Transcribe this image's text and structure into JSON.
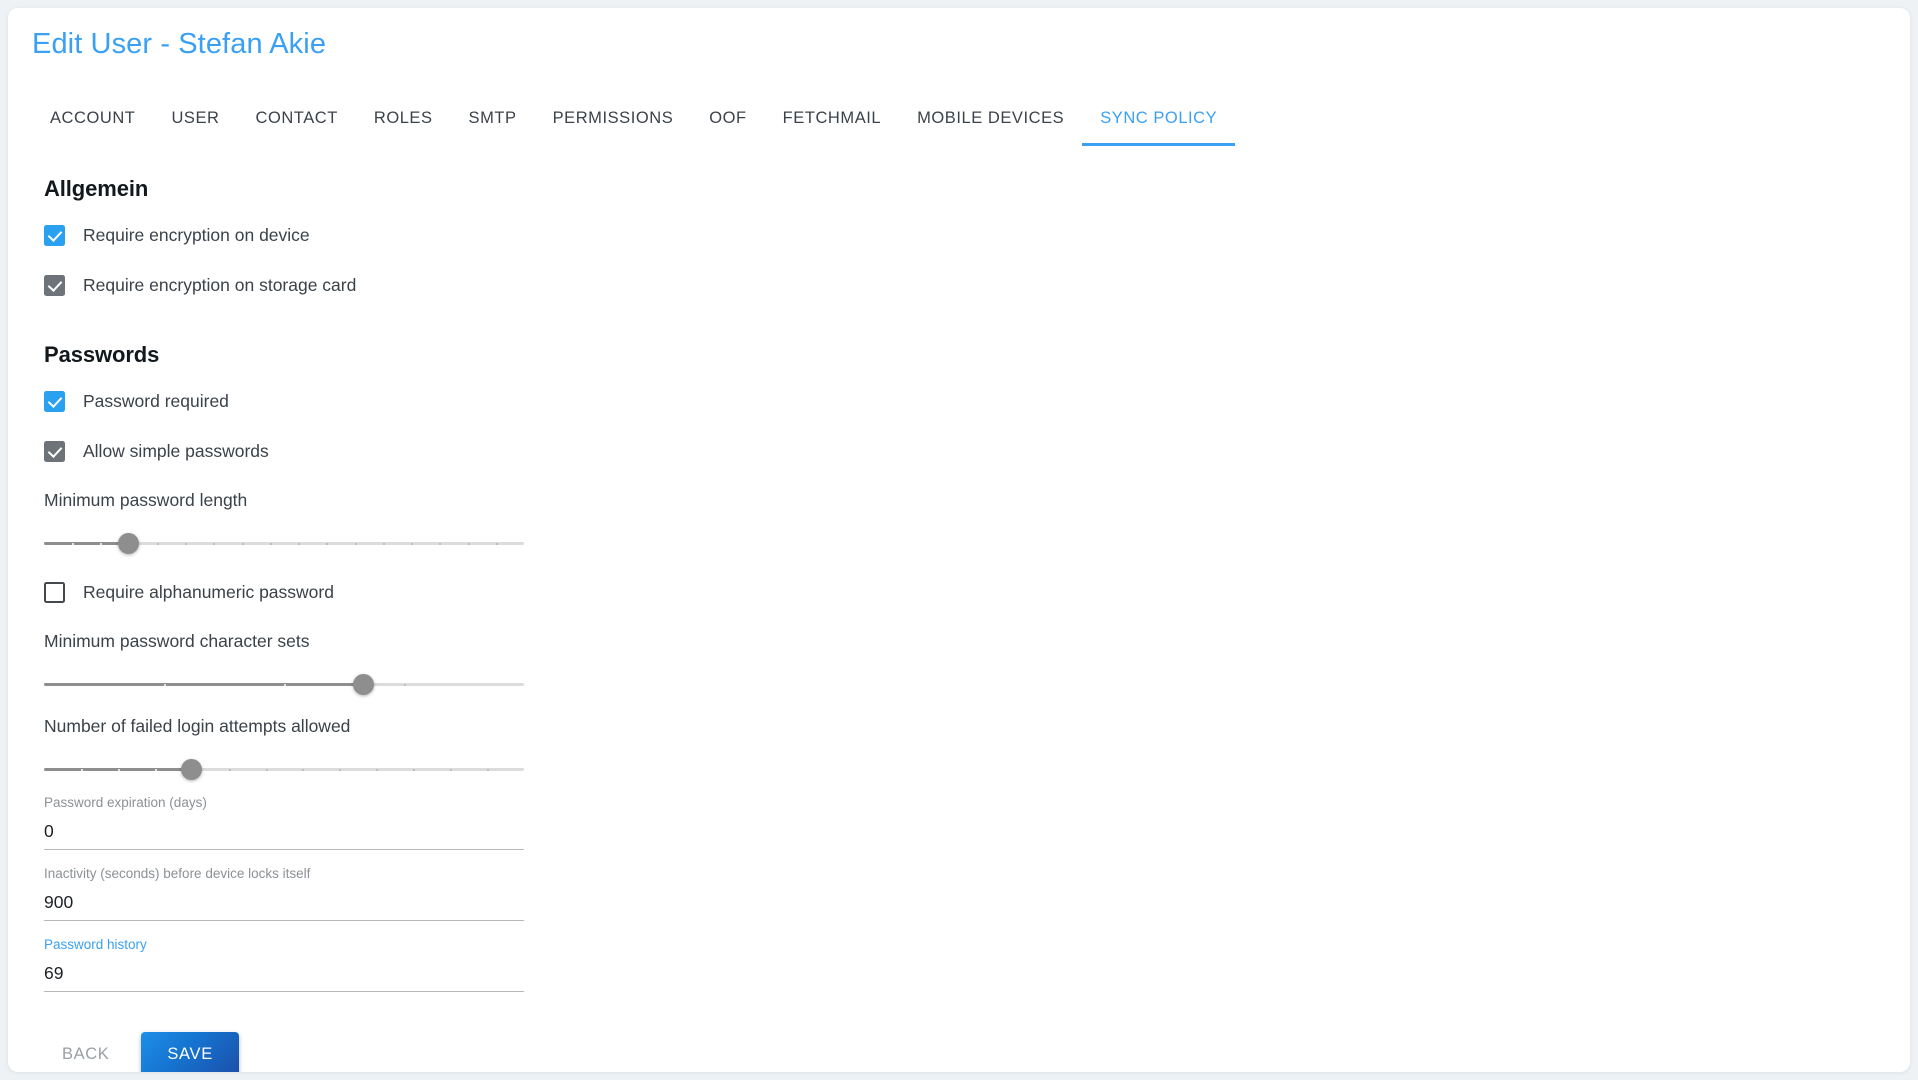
{
  "header": {
    "title": "Edit User - Stefan Akie",
    "title_color": "#3aa0f3"
  },
  "tabs": [
    {
      "label": "ACCOUNT",
      "active": false
    },
    {
      "label": "USER",
      "active": false
    },
    {
      "label": "CONTACT",
      "active": false
    },
    {
      "label": "ROLES",
      "active": false
    },
    {
      "label": "SMTP",
      "active": false
    },
    {
      "label": "PERMISSIONS",
      "active": false
    },
    {
      "label": "OOF",
      "active": false
    },
    {
      "label": "FETCHMAIL",
      "active": false
    },
    {
      "label": "MOBILE DEVICES",
      "active": false
    },
    {
      "label": "SYNC POLICY",
      "active": true
    }
  ],
  "sections": {
    "general": {
      "heading": "Allgemein",
      "checkboxes": [
        {
          "label": "Require encryption on device",
          "checked": true,
          "enabled": true
        },
        {
          "label": "Require encryption on storage card",
          "checked": true,
          "enabled": false
        }
      ]
    },
    "passwords": {
      "heading": "Passwords",
      "checkboxes": [
        {
          "label": "Password required",
          "checked": true,
          "enabled": true
        },
        {
          "label": "Allow simple passwords",
          "checked": true,
          "enabled": false
        },
        {
          "label": "Require alphanumeric password",
          "checked": false,
          "enabled": true
        }
      ],
      "sliders": [
        {
          "label": "Minimum password length",
          "value": 3,
          "min": 0,
          "max": 17,
          "ticks": 17
        },
        {
          "label": "Minimum password character sets",
          "value": 3,
          "min": 1,
          "max": 4,
          "ticks": 4
        },
        {
          "label": "Number of failed login attempts allowed",
          "value": 4,
          "min": 0,
          "max": 13,
          "ticks": 13
        }
      ],
      "fields": [
        {
          "label": "Password expiration (days)",
          "value": "0",
          "focused": false
        },
        {
          "label": "Inactivity (seconds) before device locks itself",
          "value": "900",
          "focused": false
        },
        {
          "label": "Password history",
          "value": "69",
          "focused": true
        }
      ]
    }
  },
  "actions": {
    "back_label": "BACK",
    "save_label": "SAVE"
  },
  "colors": {
    "accent": "#3aa0f3",
    "checkbox_on": "#29a0f0",
    "checkbox_disabled": "#6d7378",
    "save_gradient_start": "#1e8fe8",
    "save_gradient_end": "#1c4ea8",
    "page_background": "#eef2f5"
  }
}
